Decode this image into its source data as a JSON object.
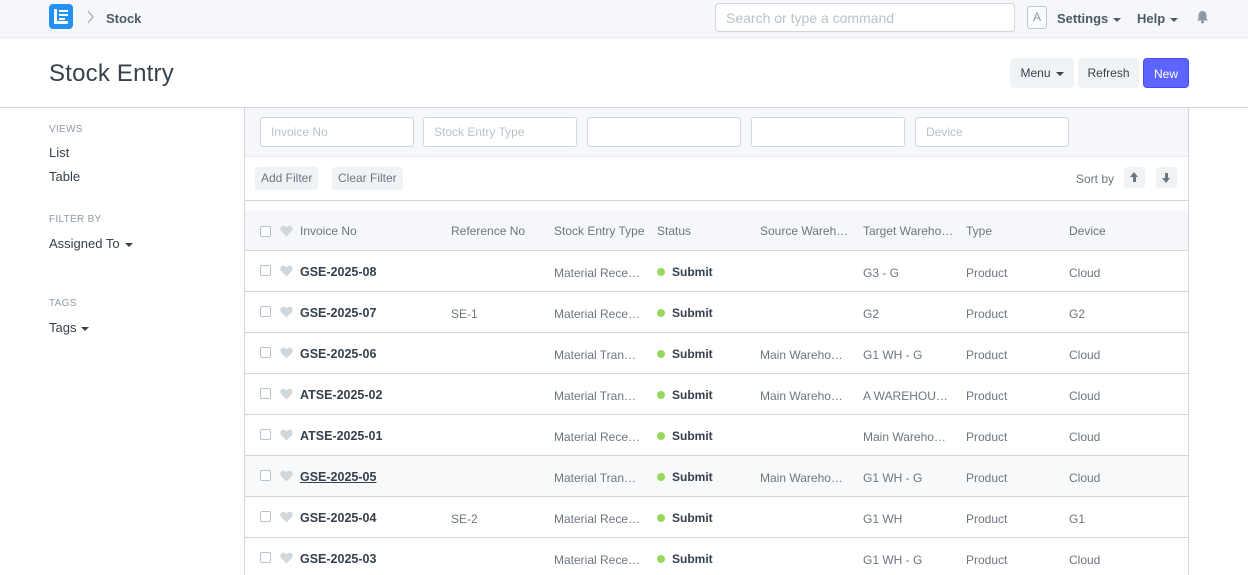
{
  "navbar": {
    "breadcrumb": "Stock",
    "search_placeholder": "Search or type a command",
    "avatar_letter": "A",
    "settings_label": "Settings",
    "help_label": "Help"
  },
  "page": {
    "title": "Stock Entry",
    "menu_label": "Menu",
    "refresh_label": "Refresh",
    "new_label": "New"
  },
  "sidebar": {
    "views_label": "VIEWS",
    "views": [
      "List",
      "Table"
    ],
    "filter_by_label": "FILTER BY",
    "assigned_to_label": "Assigned To",
    "tags_section_label": "TAGS",
    "tags_label": "Tags"
  },
  "filters": {
    "inputs": [
      {
        "placeholder": "Invoice No"
      },
      {
        "placeholder": "Stock Entry Type"
      },
      {
        "placeholder": ""
      },
      {
        "placeholder": ""
      },
      {
        "placeholder": "Device"
      }
    ],
    "add_filter_label": "Add Filter",
    "clear_filter_label": "Clear Filter",
    "sort_by_label": "Sort by"
  },
  "table": {
    "columns": [
      "Invoice No",
      "Reference No",
      "Stock Entry Type",
      "Status",
      "Source Wareh…",
      "Target Wareho…",
      "Type",
      "Device"
    ],
    "rows": [
      {
        "invoice": "GSE-2025-08",
        "ref": "",
        "entry_type": "Material Recei…",
        "status": "Submit",
        "source": "",
        "target": "G3 - G",
        "type": "Product",
        "device": "Cloud"
      },
      {
        "invoice": "GSE-2025-07",
        "ref": "SE-1",
        "entry_type": "Material Recei…",
        "status": "Submit",
        "source": "",
        "target": "G2",
        "type": "Product",
        "device": "G2"
      },
      {
        "invoice": "GSE-2025-06",
        "ref": "",
        "entry_type": "Material Transfer",
        "status": "Submit",
        "source": "Main Warehou…",
        "target": "G1 WH - G",
        "type": "Product",
        "device": "Cloud"
      },
      {
        "invoice": "ATSE-2025-02",
        "ref": "",
        "entry_type": "Material Transfer",
        "status": "Submit",
        "source": "Main Warehou…",
        "target": "A WAREHOUS…",
        "type": "Product",
        "device": "Cloud"
      },
      {
        "invoice": "ATSE-2025-01",
        "ref": "",
        "entry_type": "Material Recei…",
        "status": "Submit",
        "source": "",
        "target": "Main Warehou…",
        "type": "Product",
        "device": "Cloud"
      },
      {
        "invoice": "GSE-2025-05",
        "ref": "",
        "entry_type": "Material Transfer",
        "status": "Submit",
        "source": "Main Warehou…",
        "target": "G1 WH - G",
        "type": "Product",
        "device": "Cloud"
      },
      {
        "invoice": "GSE-2025-04",
        "ref": "SE-2",
        "entry_type": "Material Recei…",
        "status": "Submit",
        "source": "",
        "target": "G1 WH",
        "type": "Product",
        "device": "G1"
      },
      {
        "invoice": "GSE-2025-03",
        "ref": "",
        "entry_type": "Material Recei…",
        "status": "Submit",
        "source": "",
        "target": "G1 WH - G",
        "type": "Product",
        "device": "Cloud"
      }
    ]
  },
  "colors": {
    "primary": "#5e64ff",
    "status_dot": "#98d85b",
    "logo": "#2490ef"
  },
  "icons": [
    "app-logo-icon",
    "chevron-right-icon",
    "caret-down-icon",
    "bell-icon",
    "heart-icon",
    "checkbox-icon",
    "sort-ascending-icon",
    "sort-descending-icon"
  ]
}
